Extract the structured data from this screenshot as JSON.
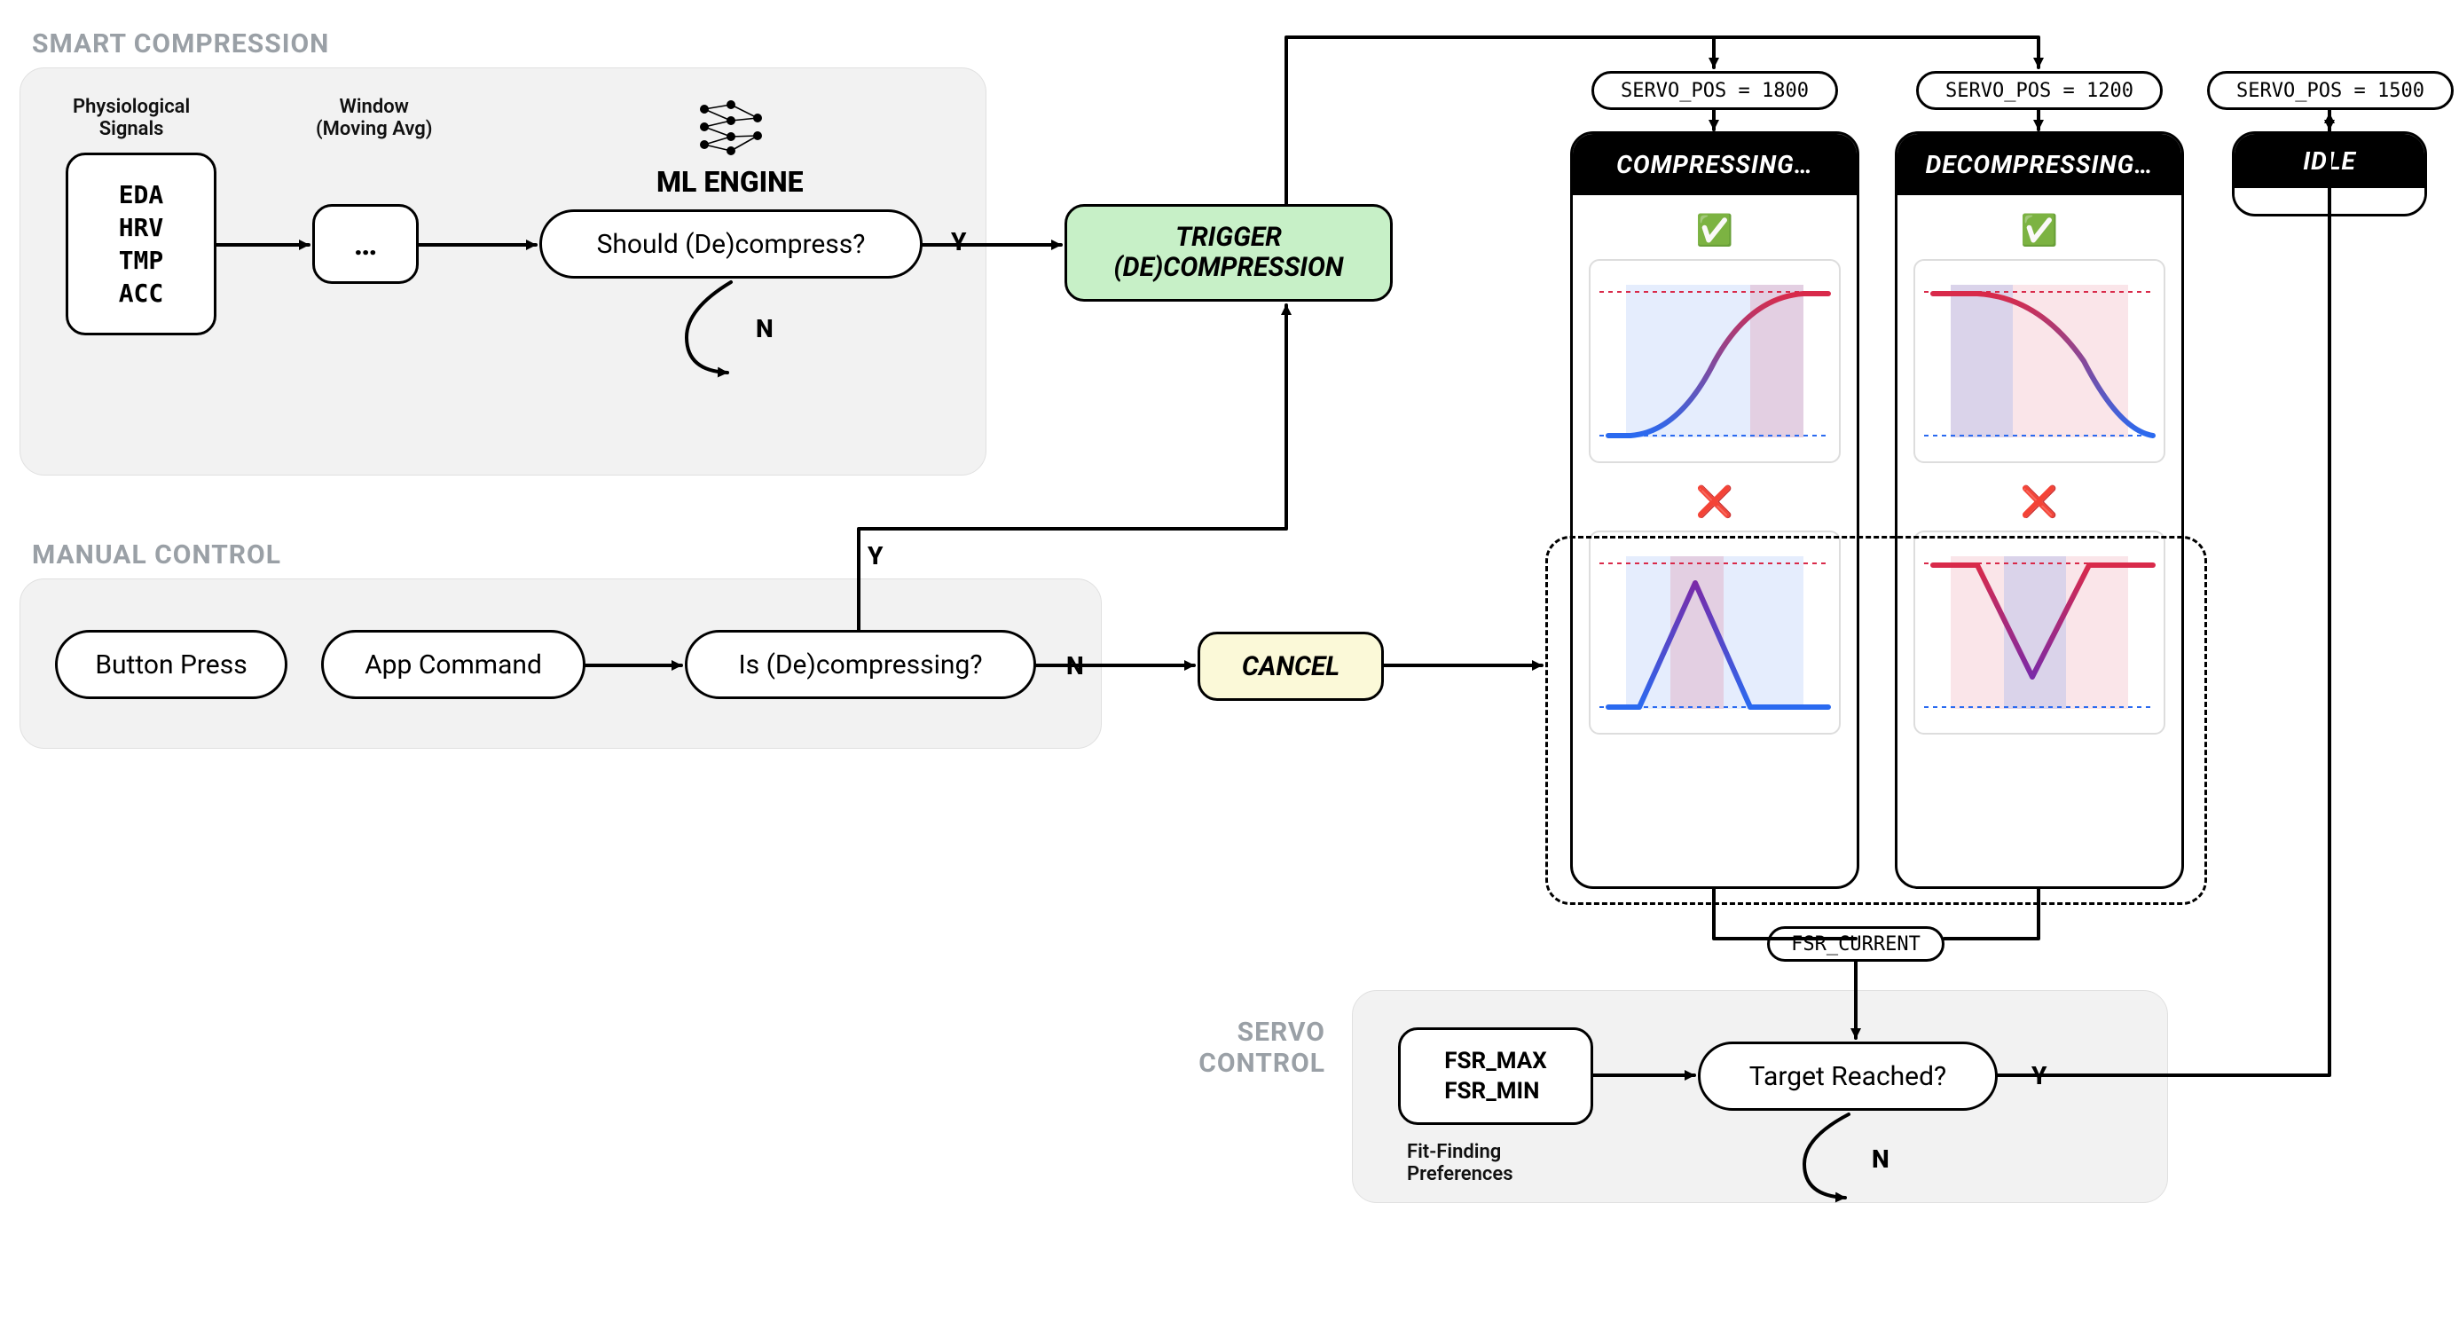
{
  "sections": {
    "smart": "SMART COMPRESSION",
    "manual": "MANUAL CONTROL",
    "servo": "SERVO\nCONTROL"
  },
  "labels": {
    "phys_signals": "Physiological\nSignals",
    "window": "Window\n(Moving Avg)",
    "ml_engine": "ML ENGINE",
    "fit_prefs": "Fit-Finding\nPreferences",
    "fsr_current": "FSR_CURRENT"
  },
  "nodes": {
    "signals": [
      "EDA",
      "HRV",
      "TMP",
      "ACC"
    ],
    "window_box": "…",
    "should_decompress": "Should (De)compress?",
    "trigger": "TRIGGER\n(DE)COMPRESSION",
    "button_press": "Button Press",
    "app_command": "App Command",
    "is_decompressing": "Is (De)compressing?",
    "cancel": "CANCEL",
    "fsr_bounds": [
      "FSR_MAX",
      "FSR_MIN"
    ],
    "target_reached": "Target Reached?"
  },
  "yn": {
    "y": "Y",
    "n": "N"
  },
  "servo_pos": {
    "var": "SERVO_POS",
    "compressing": "1800",
    "decompressing": "1200",
    "idle": "1500"
  },
  "states": {
    "compressing": "COMPRESSING…",
    "decompressing": "DECOMPRESSING…",
    "idle": "IDLE"
  },
  "status": {
    "ok": "✅",
    "fail": "❌"
  }
}
